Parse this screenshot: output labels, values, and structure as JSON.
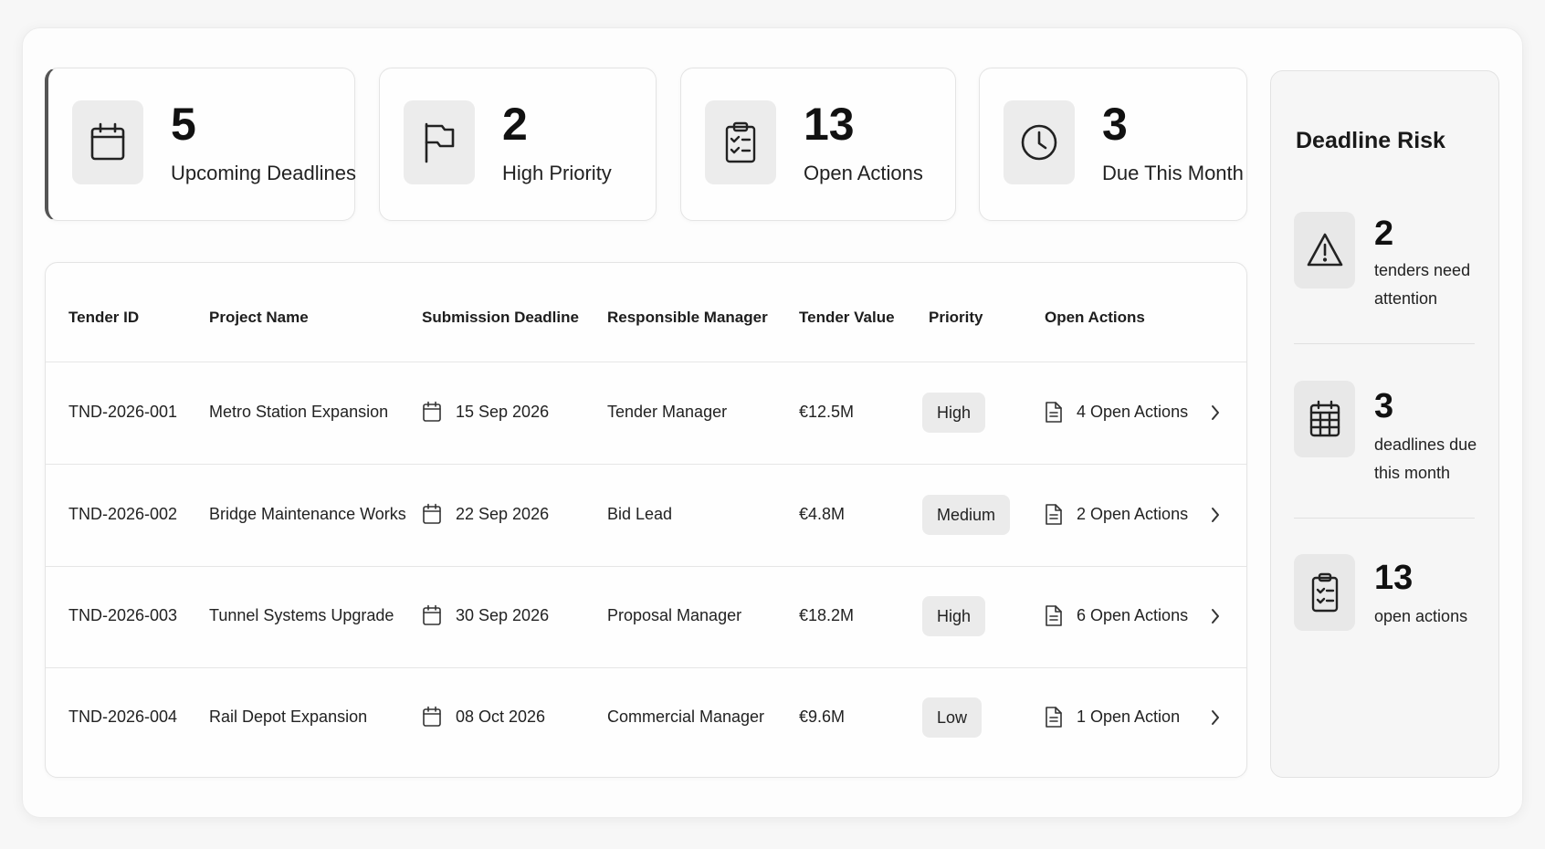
{
  "kpis": [
    {
      "value": "5",
      "label": "Upcoming Deadlines",
      "icon": "calendar-icon"
    },
    {
      "value": "2",
      "label": "High Priority",
      "icon": "flag-icon"
    },
    {
      "value": "13",
      "label": "Open Actions",
      "icon": "clipboard-check-icon"
    },
    {
      "value": "3",
      "label": "Due This Month",
      "icon": "clock-icon"
    }
  ],
  "table": {
    "headers": [
      "Tender ID",
      "Project Name",
      "Submission Deadline",
      "Responsible Manager",
      "Tender Value",
      "Priority",
      "Open Actions"
    ],
    "rows": [
      {
        "id": "TND-2026-001",
        "project": "Metro Station Expansion",
        "deadline": "15 Sep 2026",
        "manager": "Tender Manager",
        "value": "€12.5M",
        "priority": "High",
        "actions": "4 Open Actions"
      },
      {
        "id": "TND-2026-002",
        "project": "Bridge Maintenance Works",
        "deadline": "22 Sep 2026",
        "manager": "Bid Lead",
        "value": "€4.8M",
        "priority": "Medium",
        "actions": "2 Open Actions"
      },
      {
        "id": "TND-2026-003",
        "project": "Tunnel Systems Upgrade",
        "deadline": "30 Sep 2026",
        "manager": "Proposal Manager",
        "value": "€18.2M",
        "priority": "High",
        "actions": "6 Open Actions"
      },
      {
        "id": "TND-2026-004",
        "project": "Rail Depot Expansion",
        "deadline": "08 Oct 2026",
        "manager": "Commercial Manager",
        "value": "€9.6M",
        "priority": "Low",
        "actions": "1 Open Action"
      }
    ]
  },
  "risk": {
    "title": "Deadline Risk",
    "items": [
      {
        "value": "2",
        "text": "tenders need attention",
        "icon": "warning-icon"
      },
      {
        "value": "3",
        "text": "deadlines due this month",
        "icon": "calendar-grid-icon"
      },
      {
        "value": "13",
        "text": "open actions",
        "icon": "clipboard-check-icon"
      }
    ]
  }
}
